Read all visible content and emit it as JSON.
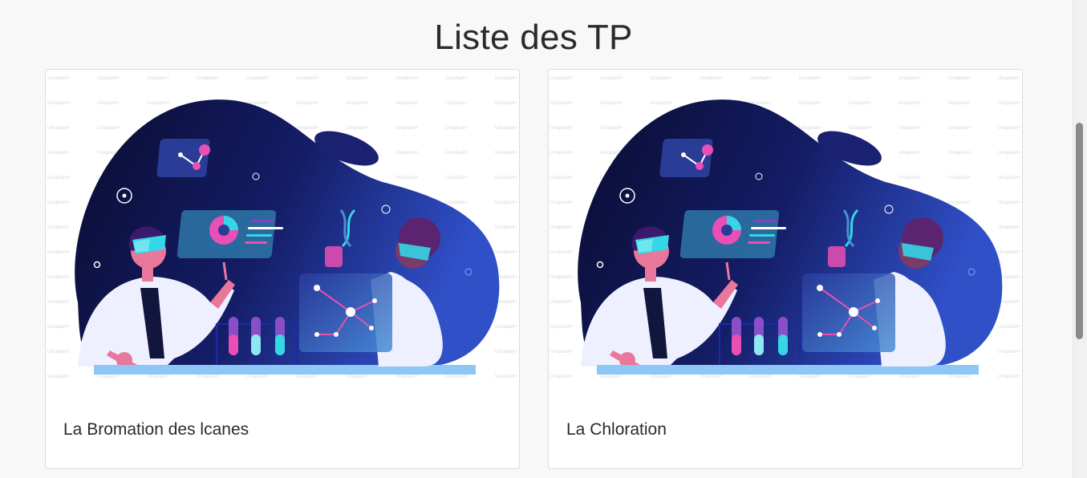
{
  "page": {
    "title": "Liste des TP"
  },
  "cards": [
    {
      "title": "La Bromation des lcanes",
      "image_icon": "science-lab-illustration"
    },
    {
      "title": "La Chloration",
      "image_icon": "science-lab-illustration"
    }
  ],
  "colors": {
    "background": "#f8f8f8",
    "blob_dark": "#0c0f3a",
    "blob_light": "#2e4fc2",
    "accent_pink": "#e94fb4",
    "accent_cyan": "#35d6e6",
    "lab_coat": "#eef0ff"
  }
}
